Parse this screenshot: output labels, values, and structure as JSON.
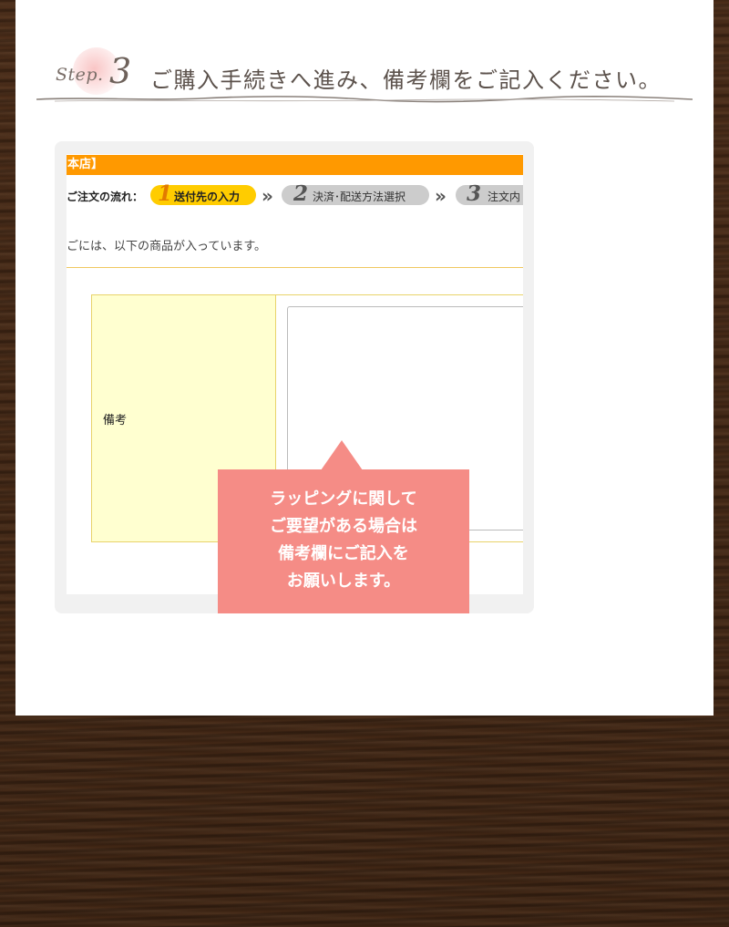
{
  "heading": {
    "step_word": "Step.",
    "step_number": "3",
    "title": "ご購入手続きへ進み、備考欄をご記入ください。"
  },
  "screenshot": {
    "shop_bar": "本店】",
    "flow": {
      "label": "ご注文の流れ：",
      "steps": [
        {
          "number": "1",
          "label": "送付先の入力"
        },
        {
          "number": "2",
          "label": "決済･配送方法選択"
        },
        {
          "number": "3",
          "label": "注文内"
        }
      ],
      "separator": "»"
    },
    "cart_message": "ごには、以下の商品が入っています。",
    "remarks": {
      "label": "備考",
      "value": ""
    }
  },
  "callout": {
    "lines": [
      "ラッピングに関して",
      "ご要望がある場合は",
      "備考欄にご記入を",
      "お願いします。"
    ]
  },
  "colors": {
    "accent_orange": "#ff9900",
    "step_active": "#ffcc00",
    "step_inactive": "#cccccc",
    "callout_pink": "#f58c86",
    "remarks_label_bg": "#ffffd0",
    "wood_background": "#3d2413"
  }
}
